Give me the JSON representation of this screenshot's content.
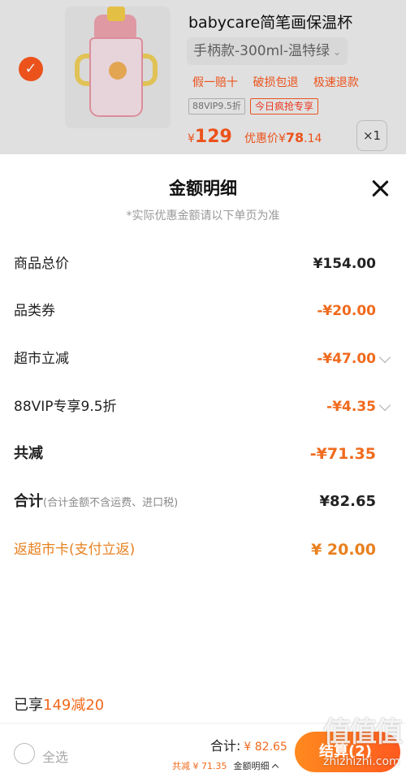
{
  "product": {
    "title": "babycare简笔画保温杯",
    "variant": "手柄款-300ml-温特绿",
    "variant_chevron": "⌄",
    "perks": [
      "假一赔十",
      "破损包退",
      "极速退款"
    ],
    "tag_vip": "88VIP9.5折",
    "tag_daily": "今日疯抢专享",
    "price_currency": "¥",
    "price": "129",
    "discount_label": "优惠价¥",
    "discount_int": "78",
    "discount_dec": ".14",
    "quantity": "×1",
    "selected": true,
    "checkmark": "✓"
  },
  "sheet": {
    "title": "金额明细",
    "subtitle": "*实际优惠金额请以下单页为准",
    "rows": [
      {
        "label": "商品总价",
        "amount": "¥154.00"
      },
      {
        "label": "品类券",
        "amount": "-¥20.00"
      },
      {
        "label": "超市立减",
        "amount": "-¥47.00"
      },
      {
        "label": "88VIP专享9.5折",
        "amount": "-¥4.35"
      }
    ],
    "total_reduction_label": "共减",
    "total_reduction_amount": "-¥71.35",
    "sum_label": "合计",
    "sum_note": "(合计金额不含运费、进口税)",
    "sum_amount": "¥82.65",
    "refund_label": "返超市卡(支付立返)",
    "refund_amount": "¥ 20.00",
    "enjoy_prefix": "已享",
    "enjoy_value": "149减20"
  },
  "bottom_bar": {
    "select_all": "全选",
    "total_label": "合计:",
    "total_value": "¥ 82.65",
    "reduction": "共减 ¥ 71.35",
    "detail_label": "金额明细",
    "checkout": "结算(2)"
  },
  "watermark": {
    "glyphs": "值值值",
    "site": "zhizhizhi.com"
  },
  "colors": {
    "accent": "#f06a1d",
    "brand_orange": "#ff5a1f",
    "refund": "#e8801f"
  }
}
